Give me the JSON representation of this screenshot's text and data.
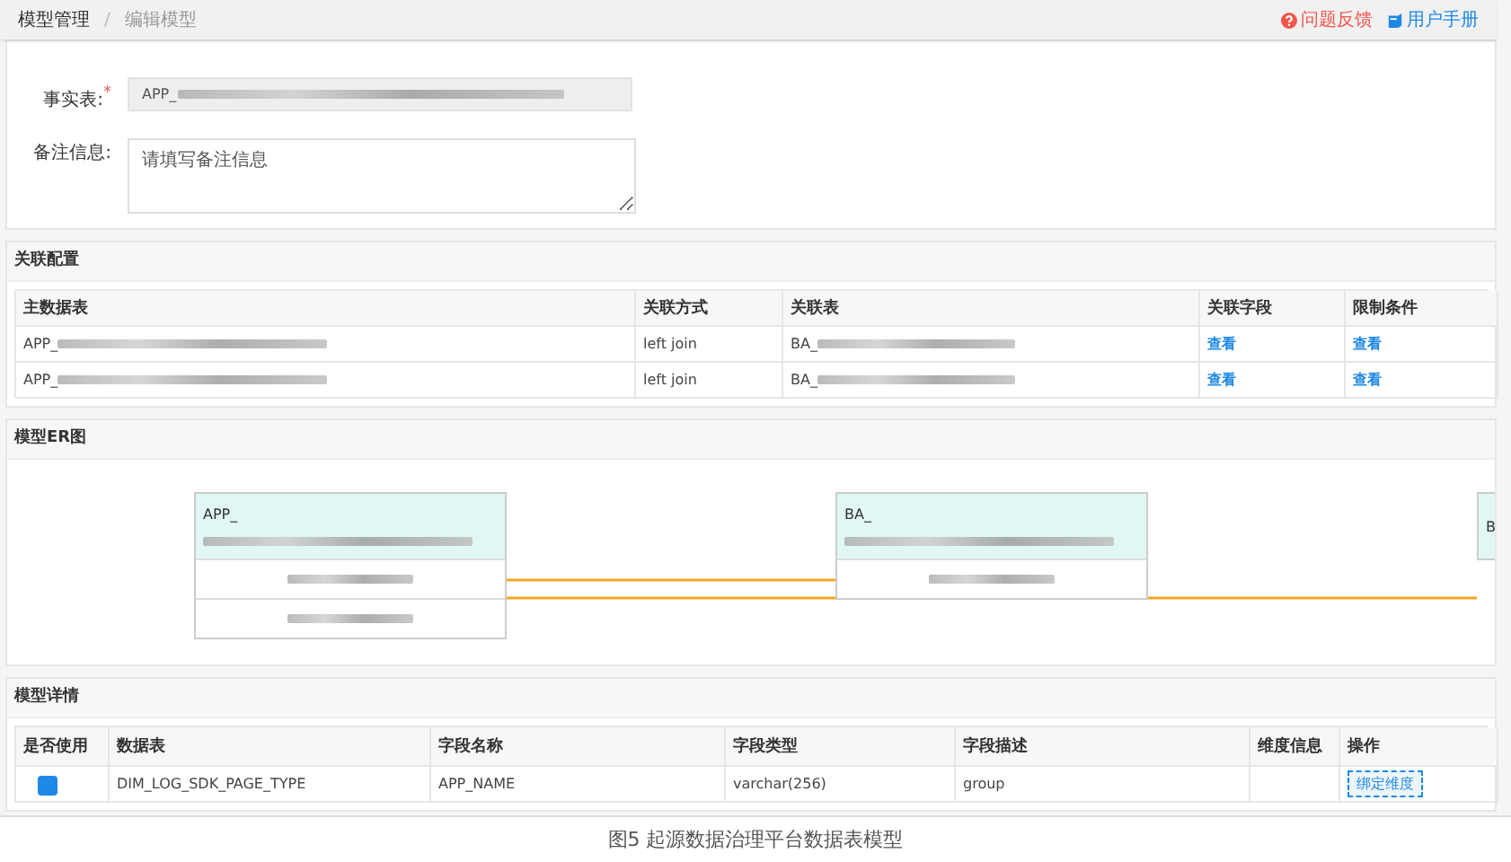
{
  "breadcrumb": [
    {
      "label": "模型管理",
      "selected": false
    },
    {
      "label": "编辑模型",
      "selected": true
    }
  ],
  "breadcrumb_separator": "/",
  "header_links": [
    {
      "kind": "help",
      "label": "问题反馈"
    },
    {
      "kind": "manual",
      "label": "用户手册"
    }
  ],
  "required_mark": "*",
  "form": {
    "fields": [
      {
        "label": "事实表:",
        "required": true,
        "kind": "readonly",
        "value": "APP_",
        "redacted": true
      },
      {
        "label": "备注信息:",
        "required": false,
        "kind": "textarea",
        "placeholder": "请填写备注信息"
      }
    ]
  },
  "join_config": {
    "title": "关联配置",
    "columns": [
      "主数据表",
      "关联方式",
      "关联表",
      "关联字段",
      "限制条件"
    ],
    "rows": [
      {
        "main_table": {
          "text": "APP_",
          "redacted": true
        },
        "join_type": "left join",
        "join_table": {
          "text": "BA_",
          "redacted": true
        },
        "fields_link": "查看",
        "conditions_link": "查看"
      },
      {
        "main_table": {
          "text": "APP_",
          "redacted": true
        },
        "join_type": "left join",
        "join_table": {
          "text": "BA_",
          "redacted": true
        },
        "fields_link": "查看",
        "conditions_link": "查看"
      }
    ]
  },
  "er_diagram": {
    "title": "模型ER图",
    "nodes": [
      {
        "title": "APP_",
        "redacted": true,
        "fields": [
          {
            "redacted": true
          },
          {
            "redacted": true
          }
        ]
      },
      {
        "title": "BA_",
        "redacted": true,
        "fields": [
          {
            "redacted": true
          }
        ]
      },
      {
        "title": "B"
      }
    ]
  },
  "model_detail": {
    "title": "模型详情",
    "columns": [
      "是否使用",
      "数据表",
      "字段名称",
      "字段类型",
      "字段描述",
      "维度信息",
      "操作"
    ],
    "rows": [
      {
        "in_use": true,
        "table": "DIM_LOG_SDK_PAGE_TYPE",
        "field": "APP_NAME",
        "type": "varchar(256)",
        "description": "group",
        "action": "绑定维度"
      }
    ]
  },
  "caption": "图5  起源数据治理平台数据表模型"
}
